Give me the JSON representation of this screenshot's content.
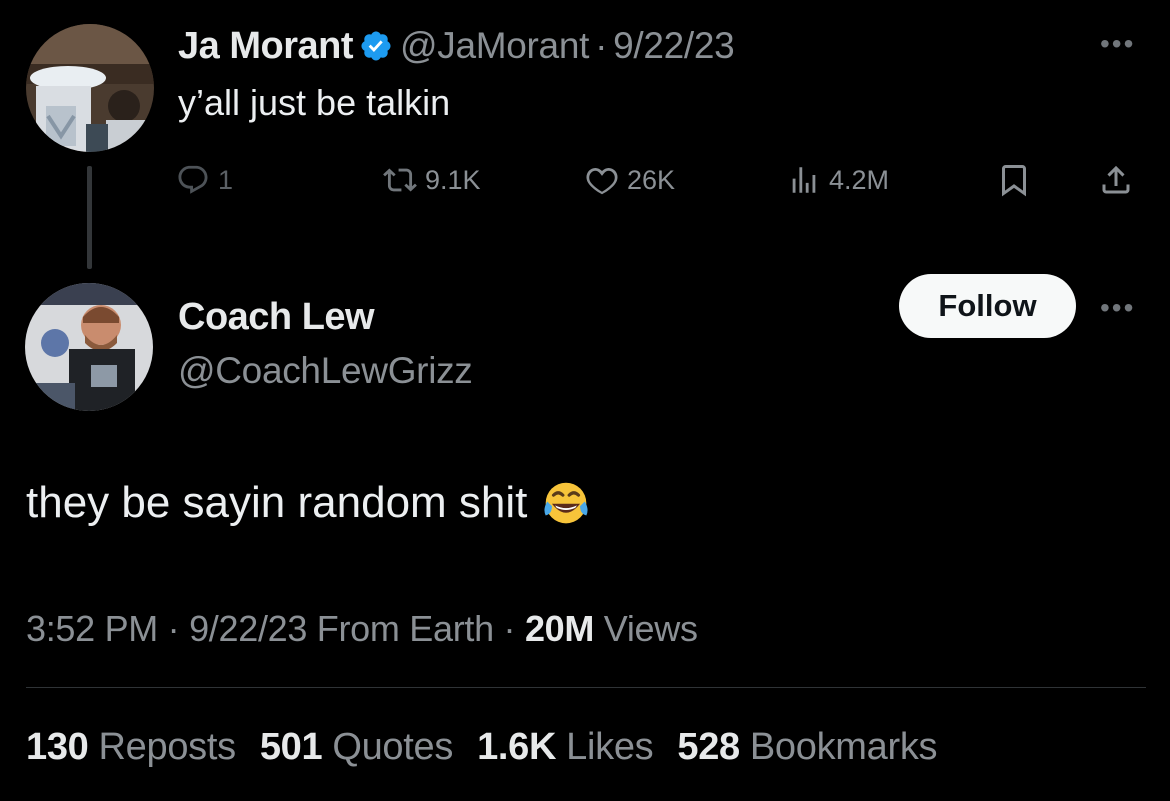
{
  "parent_tweet": {
    "display_name": "Ja Morant",
    "verified": true,
    "handle": "@JaMorant",
    "separator": "·",
    "date": "9/22/23",
    "text": "y’all just be talkin",
    "replies": "1",
    "reposts": "9.1K",
    "likes": "26K",
    "views": "4.2M",
    "icons": [
      "reply-icon",
      "repost-icon",
      "like-icon",
      "views-icon",
      "bookmark-icon",
      "share-icon",
      "more-icon"
    ]
  },
  "reply_tweet": {
    "display_name": "Coach Lew",
    "handle": "@CoachLewGrizz",
    "follow_label": "Follow",
    "text": "they be sayin random shit",
    "emoji": "face-with-tears-of-joy",
    "time": "3:52 PM",
    "separator": "·",
    "date": "9/22/23",
    "source": "From Earth",
    "views_count": "20M",
    "views_label": "Views"
  },
  "stats": [
    {
      "value": "130",
      "label": "Reposts"
    },
    {
      "value": "501",
      "label": "Quotes"
    },
    {
      "value": "1.6K",
      "label": "Likes"
    },
    {
      "value": "528",
      "label": "Bookmarks"
    }
  ],
  "colors": {
    "background": "#000000",
    "primary_text": "#e7e9ea",
    "secondary_text": "#8b9095",
    "verified_blue": "#1d9bf0",
    "follow_bg": "#f7f9f9",
    "divider": "#2f3336"
  }
}
